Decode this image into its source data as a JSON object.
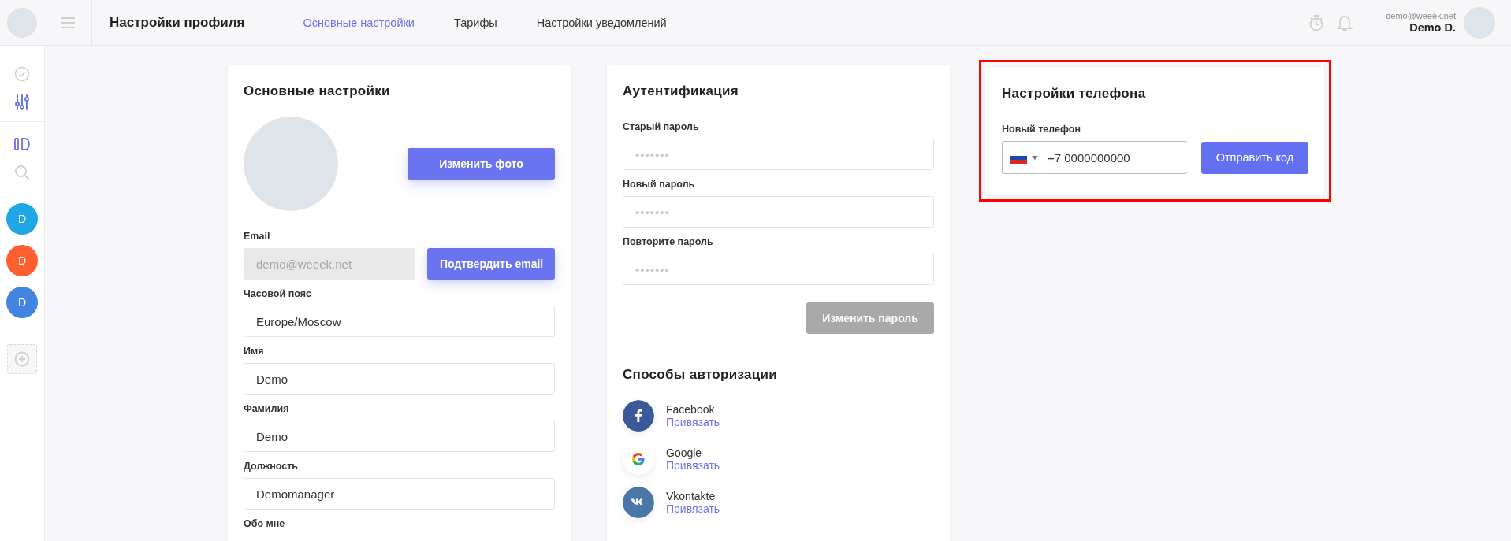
{
  "header": {
    "title": "Настройки профиля",
    "tabs": [
      {
        "label": "Основные настройки",
        "selected": true
      },
      {
        "label": "Тарифы",
        "selected": false
      },
      {
        "label": "Настройки уведомлений",
        "selected": false
      }
    ],
    "user": {
      "email": "demo@weeek.net",
      "name": "Demo D."
    }
  },
  "sidebar": {
    "items": [
      {
        "kind": "check",
        "selected": false
      },
      {
        "kind": "sliders",
        "selected": true
      },
      {
        "kind": "board",
        "selected": true
      },
      {
        "kind": "search",
        "selected": false
      }
    ],
    "workspaces": [
      {
        "label": "D",
        "color": "#1ea7e4"
      },
      {
        "label": "D",
        "color": "#ff5f2e"
      },
      {
        "label": "D",
        "color": "#4285e0"
      }
    ]
  },
  "basic_settings": {
    "title": "Основные настройки",
    "photo_button": "Изменить фото",
    "fields": [
      {
        "label": "Email",
        "value": "demo@weeek.net",
        "disabled": true,
        "action": "Подтвердить email"
      },
      {
        "label": "Часовой пояс",
        "value": "Europe/Moscow",
        "disabled": false
      },
      {
        "label": "Имя",
        "value": "Demo",
        "disabled": false
      },
      {
        "label": "Фамилия",
        "value": "Demo",
        "disabled": false
      },
      {
        "label": "Должность",
        "value": "Demomanager",
        "disabled": false
      }
    ],
    "next_label": "Обо мне"
  },
  "authentication": {
    "title": "Аутентификация",
    "fields": [
      {
        "label": "Старый пароль",
        "placeholder": "•••••••"
      },
      {
        "label": "Новый пароль",
        "placeholder": "•••••••"
      },
      {
        "label": "Повторите пароль",
        "placeholder": "•••••••"
      }
    ],
    "button": {
      "label": "Изменить пароль",
      "disabled": true
    },
    "methods_title": "Способы авторизации",
    "methods": [
      {
        "kind": "facebook",
        "name": "Facebook",
        "link": "Привязать"
      },
      {
        "kind": "google",
        "name": "Google",
        "link": "Привязать"
      },
      {
        "kind": "vk",
        "name": "Vkontakte",
        "link": "Привязать"
      }
    ]
  },
  "phone_settings": {
    "title": "Настройки телефона",
    "highlighted": true,
    "label": "Новый телефон",
    "value": "+7 0000000000",
    "button": "Отправить код"
  }
}
